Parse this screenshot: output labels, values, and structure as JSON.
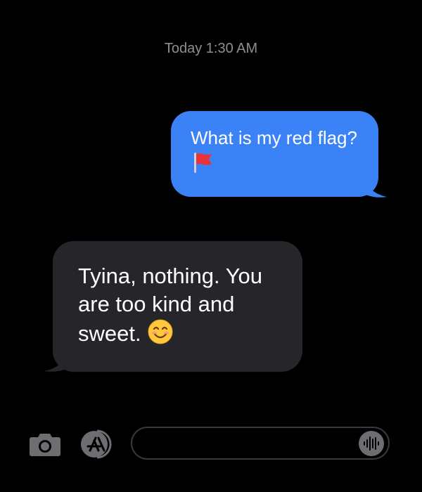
{
  "thread": {
    "timestamp": "Today 1:30 AM",
    "messages": [
      {
        "direction": "outgoing",
        "text": "What is my red flag?",
        "emoji": "red-flag-icon"
      },
      {
        "direction": "incoming",
        "text": "Tyina, nothing. You are too kind and sweet.",
        "emoji": "smiling-face-icon"
      }
    ]
  },
  "composer": {
    "value": "",
    "placeholder": ""
  },
  "colors": {
    "background": "#000000",
    "outgoing_bubble": "#3b82f6",
    "incoming_bubble": "#26252a",
    "timestamp_text": "#8e8e93",
    "icon_gray": "#6d6d72"
  },
  "icons": {
    "camera": "camera-icon",
    "apps": "app-store-icon",
    "audio": "waveform-icon"
  }
}
